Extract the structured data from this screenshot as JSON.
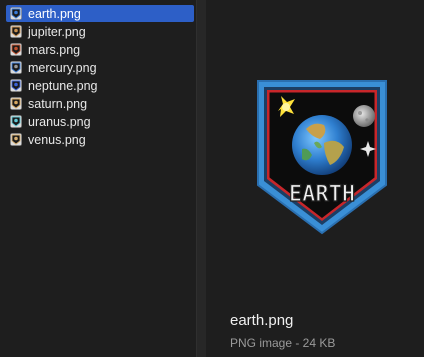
{
  "files": [
    {
      "name": "earth.png",
      "selected": true,
      "accent": "#3a7bd5"
    },
    {
      "name": "jupiter.png",
      "selected": false,
      "accent": "#c9904f"
    },
    {
      "name": "mars.png",
      "selected": false,
      "accent": "#c0502c"
    },
    {
      "name": "mercury.png",
      "selected": false,
      "accent": "#9a9a9a"
    },
    {
      "name": "neptune.png",
      "selected": false,
      "accent": "#3c63d8"
    },
    {
      "name": "saturn.png",
      "selected": false,
      "accent": "#d8a860"
    },
    {
      "name": "uranus.png",
      "selected": false,
      "accent": "#5fc9d6"
    },
    {
      "name": "venus.png",
      "selected": false,
      "accent": "#d8b070"
    }
  ],
  "preview": {
    "file_name": "earth.png",
    "file_info": "PNG image - 24 KB",
    "badge_text": "EARTH"
  },
  "colors": {
    "selection": "#2d5fc7",
    "badge_outer": "#3a8fd6",
    "badge_inner": "#0c0c0c",
    "badge_red": "#c8262a"
  }
}
